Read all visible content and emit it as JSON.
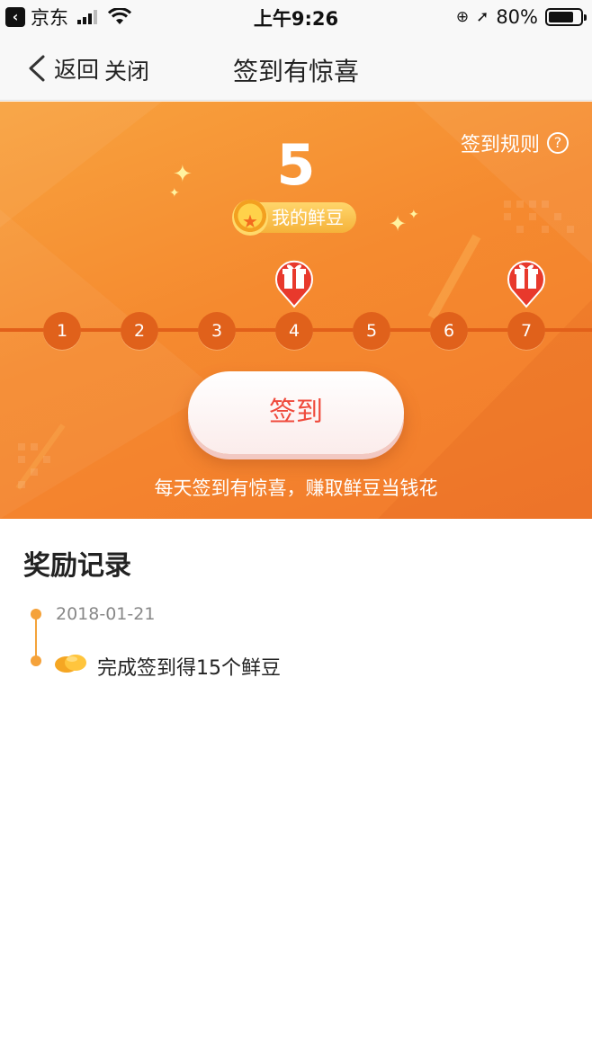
{
  "status_bar": {
    "carrier": "京东",
    "time": "上午9:26",
    "battery": "80%",
    "battery_level": 0.8
  },
  "nav": {
    "back_label": "返回",
    "close_label": "关闭",
    "title": "签到有惊喜"
  },
  "banner": {
    "rules_label": "签到规则",
    "count": "5",
    "beans_label": "我的鲜豆",
    "days": [
      "1",
      "2",
      "3",
      "4",
      "5",
      "6",
      "7"
    ],
    "gift_days": [
      "4",
      "7"
    ],
    "checkin_label": "签到",
    "tagline": "每天签到有惊喜，赚取鲜豆当钱花"
  },
  "records": {
    "title": "奖励记录",
    "items": [
      {
        "date": "2018-01-21",
        "text": "完成签到得15个鲜豆"
      }
    ]
  },
  "colors": {
    "banner_orange": "#f58a2f",
    "track": "#e0611b",
    "button_text": "#ef4a3c",
    "timeline": "#f5a23a"
  },
  "icons": [
    "back-icon",
    "wifi-icon",
    "lock-rotation-icon",
    "location-icon",
    "battery-icon",
    "help-icon",
    "coin-icon",
    "gift-icon",
    "beans-icon"
  ]
}
